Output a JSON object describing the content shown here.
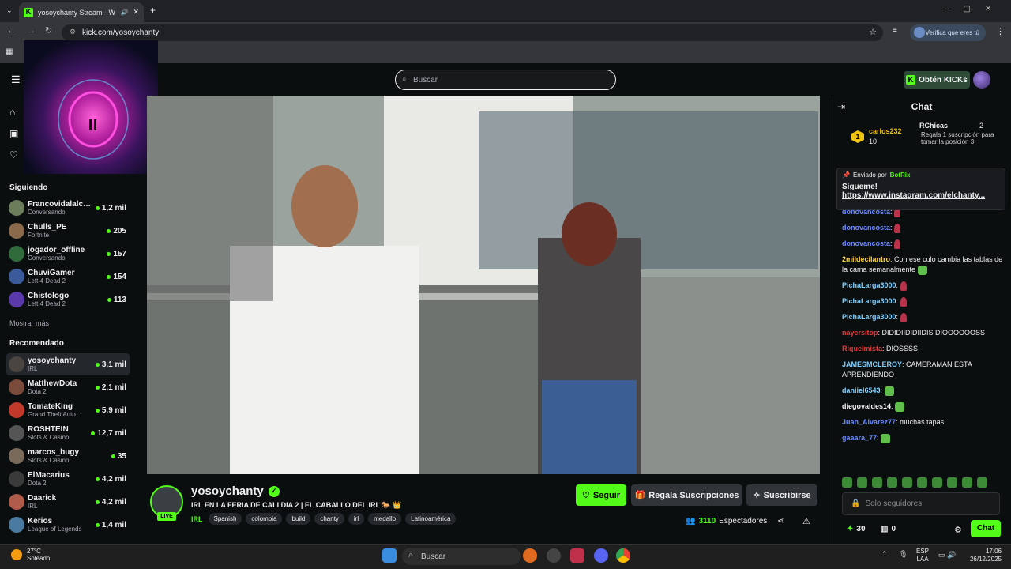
{
  "browser": {
    "tab_title": "yosoychanty Stream - Watch",
    "url": "kick.com/yosoychanty",
    "verify_label": "Verifica que eres tú"
  },
  "header": {
    "search_placeholder": "Buscar",
    "get_kicks": "Obtén KICKs"
  },
  "sidebar": {
    "following_title": "Siguiendo",
    "following": [
      {
        "name": "Francovidalalca...",
        "category": "Conversando",
        "viewers": "1,2 mil",
        "color": "#6b7d5a"
      },
      {
        "name": "Chulls_PE",
        "category": "Fortnite",
        "viewers": "205",
        "color": "#8a6a4a"
      },
      {
        "name": "jogador_offline",
        "category": "Conversando",
        "viewers": "157",
        "color": "#2f6b3b"
      },
      {
        "name": "ChuviGamer",
        "category": "Left 4 Dead 2",
        "viewers": "154",
        "color": "#3a5a9a"
      },
      {
        "name": "Chistologo",
        "category": "Left 4 Dead 2",
        "viewers": "113",
        "color": "#5a3aaa"
      }
    ],
    "show_more": "Mostrar más",
    "recommended_title": "Recomendado",
    "recommended": [
      {
        "name": "yosoychanty",
        "category": "IRL",
        "viewers": "3,1 mil",
        "color": "#4a4540"
      },
      {
        "name": "MatthewDota",
        "category": "Dota 2",
        "viewers": "2,1 mil",
        "color": "#7a4a3a"
      },
      {
        "name": "TomateKing",
        "category": "Grand Theft Auto ...",
        "viewers": "5,9 mil",
        "color": "#c0392b"
      },
      {
        "name": "ROSHTEIN",
        "category": "Slots & Casino",
        "viewers": "12,7 mil",
        "color": "#555555"
      },
      {
        "name": "marcos_bugy",
        "category": "Slots & Casino",
        "viewers": "35",
        "color": "#7a6a5a"
      },
      {
        "name": "ElMacarius",
        "category": "Dota 2",
        "viewers": "4,2 mil",
        "color": "#3a3a3a"
      },
      {
        "name": "Daarick",
        "category": "IRL",
        "viewers": "4,2 mil",
        "color": "#b05a4a"
      },
      {
        "name": "Kerios",
        "category": "League of Legends",
        "viewers": "1,4 mil",
        "color": "#4a7aa0"
      }
    ]
  },
  "stream": {
    "streamer": "yosoychanty",
    "live": "LIVE",
    "title": "IRL EN LA FERIA DE CALI DIA 2 | EL CABALLO DEL IRL 🐎 👑",
    "category": "IRL",
    "tags": [
      "Spanish",
      "colombia",
      "build",
      "chanty",
      "irl",
      "medallo",
      "Latinoamérica"
    ],
    "follow": "Seguir",
    "gift": "Regala Suscripciones",
    "subscribe": "Suscribirse",
    "viewers_count": "3110",
    "viewers_label": "Espectadores"
  },
  "chat": {
    "title": "Chat",
    "leader1": {
      "rank": "1",
      "name": "carlos232",
      "value": "10"
    },
    "leader2": {
      "name": "RChicas",
      "value": "2",
      "note": "Regala 1 suscripción para tomar la posición 3"
    },
    "pinned": {
      "sent_by": "Enviado por",
      "bot": "BotRix",
      "message": "Sigueme!",
      "link": "https://www.instagram.com/elchanty..."
    },
    "messages": [
      {
        "user": "donovancosta",
        "text": "",
        "color": "#6a8cff",
        "emote": "red"
      },
      {
        "user": "donovancosta",
        "text": "",
        "color": "#6a8cff",
        "emote": "red"
      },
      {
        "user": "donovancosta",
        "text": "",
        "color": "#6a8cff",
        "emote": "red"
      },
      {
        "user": "2mildecilantro",
        "text": "Con ese culo cambia las tablas de la cama semanalmente",
        "color": "#ffd43b",
        "emote": "green"
      },
      {
        "user": "PichaLarga3000",
        "text": "",
        "color": "#7ed0ff",
        "emote": "red"
      },
      {
        "user": "PichaLarga3000",
        "text": "",
        "color": "#7ed0ff",
        "emote": "red"
      },
      {
        "user": "PichaLarga3000",
        "text": "",
        "color": "#7ed0ff",
        "emote": "red"
      },
      {
        "user": "nayersitop",
        "text": "DIDIDIIDIDIIDIS DIOOOOOOSS",
        "color": "#e03b3b",
        "emote": ""
      },
      {
        "user": "Riquelmista",
        "text": "DIOSSSS",
        "color": "#e03b3b",
        "emote": ""
      },
      {
        "user": "JAMESMCLEROY",
        "text": "CAMERAMAN ESTA APRENDIENDO",
        "color": "#7ed0ff",
        "emote": ""
      },
      {
        "user": "daniiel6543",
        "text": "",
        "color": "#7ed0ff",
        "emote": "green"
      },
      {
        "user": "diegovaldes14",
        "text": "",
        "color": "#efeff1",
        "emote": "green"
      },
      {
        "user": "Juan_Alvarez77",
        "text": "muchas tapas",
        "color": "#6a8cff",
        "emote": ""
      },
      {
        "user": "gaaara_77",
        "text": "",
        "color": "#6a8cff",
        "emote": "green"
      }
    ],
    "input_placeholder": "Solo seguidores",
    "points": "30",
    "coins": "0",
    "chat_button": "Chat"
  },
  "taskbar": {
    "temperature": "27°C",
    "weather": "Soleado",
    "search": "Buscar",
    "lang1": "ESP",
    "lang2": "LAA",
    "time": "17:06",
    "date": "26/12/2025"
  },
  "colors": {
    "accent": "#53fc18",
    "background": "#0b0e0f"
  }
}
